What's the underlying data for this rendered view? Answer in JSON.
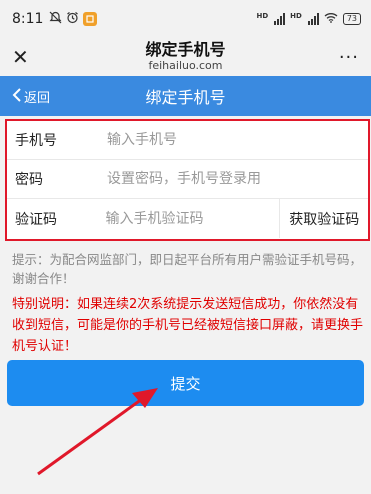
{
  "status_bar": {
    "time": "8:11",
    "tag1": "HD",
    "tag2": "HD",
    "battery": "73"
  },
  "browser": {
    "title": "绑定手机号",
    "url": "feihailuo.com",
    "close_glyph": "✕",
    "more_glyph": "···"
  },
  "header": {
    "back_label": "返回",
    "title": "绑定手机号"
  },
  "form": {
    "phone_label": "手机号",
    "phone_placeholder": "输入手机号",
    "password_label": "密码",
    "password_placeholder": "设置密码，手机号登录用",
    "code_label": "验证码",
    "code_placeholder": "输入手机验证码",
    "get_code_label": "获取验证码"
  },
  "tip": "提示：为配合网监部门，即日起平台所有用户需验证手机号码，谢谢合作！",
  "notice": "特别说明：如果连续2次系统提示发送短信成功，你依然没有收到短信，可能是你的手机号已经被短信接口屏蔽，请更换手机号认证！",
  "submit_label": "提交",
  "colors": {
    "header_blue": "#3a8ae0",
    "button_blue": "#1d8cf0",
    "highlight_red": "#e0182a",
    "notice_red": "#e00000"
  },
  "icons": [
    "alarm-off-icon",
    "alarm-icon",
    "app-badge-icon",
    "signal-icon",
    "wifi-icon",
    "battery-icon",
    "close-icon",
    "more-icon",
    "chevron-left-icon",
    "annotation-arrow"
  ]
}
